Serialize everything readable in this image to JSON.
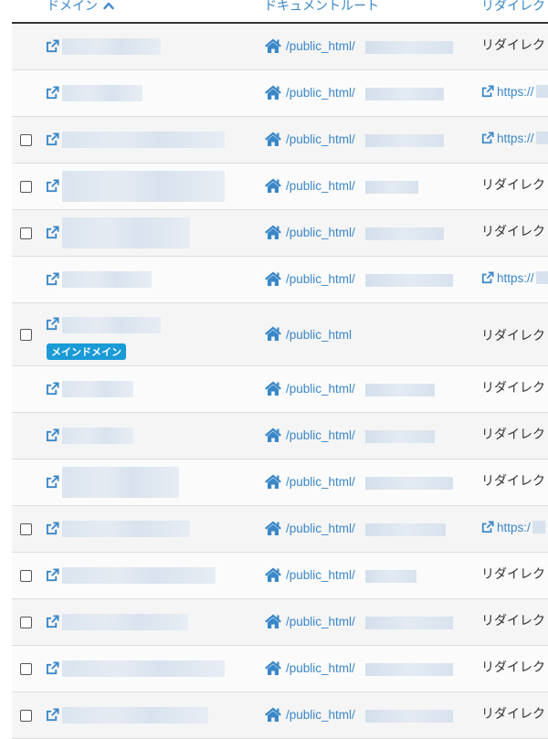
{
  "header": {
    "domain_label": "ドメイン",
    "sort_icon": "chevron-up-icon",
    "docroot_label": "ドキュメントルート",
    "redirect_label": "リダイレク"
  },
  "main_badge_label": "メインドメイン",
  "rows": [
    {
      "checkbox": false,
      "docroot": "/public_html/",
      "redirect_type": "text",
      "redirect": "リダイレク"
    },
    {
      "checkbox": false,
      "docroot": "/public_html/",
      "redirect_type": "link",
      "redirect": "https://"
    },
    {
      "checkbox": true,
      "docroot": "/public_html/",
      "redirect_type": "link",
      "redirect": "https://"
    },
    {
      "checkbox": true,
      "docroot": "/public_html/",
      "redirect_type": "text",
      "redirect": "リダイレク"
    },
    {
      "checkbox": true,
      "docroot": "/public_html/",
      "redirect_type": "text",
      "redirect": "リダイレク"
    },
    {
      "checkbox": false,
      "docroot": "/public_html/",
      "redirect_type": "link",
      "redirect": "https://"
    },
    {
      "checkbox": true,
      "docroot": "/public_html",
      "redirect_type": "text",
      "redirect": "リダイレク",
      "main": true
    },
    {
      "checkbox": false,
      "docroot": "/public_html/",
      "redirect_type": "text",
      "redirect": "リダイレク"
    },
    {
      "checkbox": false,
      "docroot": "/public_html/",
      "redirect_type": "text",
      "redirect": "リダイレク"
    },
    {
      "checkbox": false,
      "docroot": "/public_html/",
      "redirect_type": "text",
      "redirect": "リダイレク"
    },
    {
      "checkbox": true,
      "docroot": "/public_html/",
      "redirect_type": "link",
      "redirect": "https:/"
    },
    {
      "checkbox": true,
      "docroot": "/public_html/",
      "redirect_type": "text",
      "redirect": "リダイレク"
    },
    {
      "checkbox": true,
      "docroot": "/public_html/",
      "redirect_type": "text",
      "redirect": "リダイレク"
    },
    {
      "checkbox": true,
      "docroot": "/public_html/",
      "redirect_type": "text",
      "redirect": "リダイレク"
    },
    {
      "checkbox": true,
      "docroot": "/public_html/",
      "redirect_type": "text",
      "redirect": "リダイレク"
    }
  ],
  "colors": {
    "link": "#3a87c8",
    "badge": "#1a9bd7",
    "header_border": "#333333"
  }
}
